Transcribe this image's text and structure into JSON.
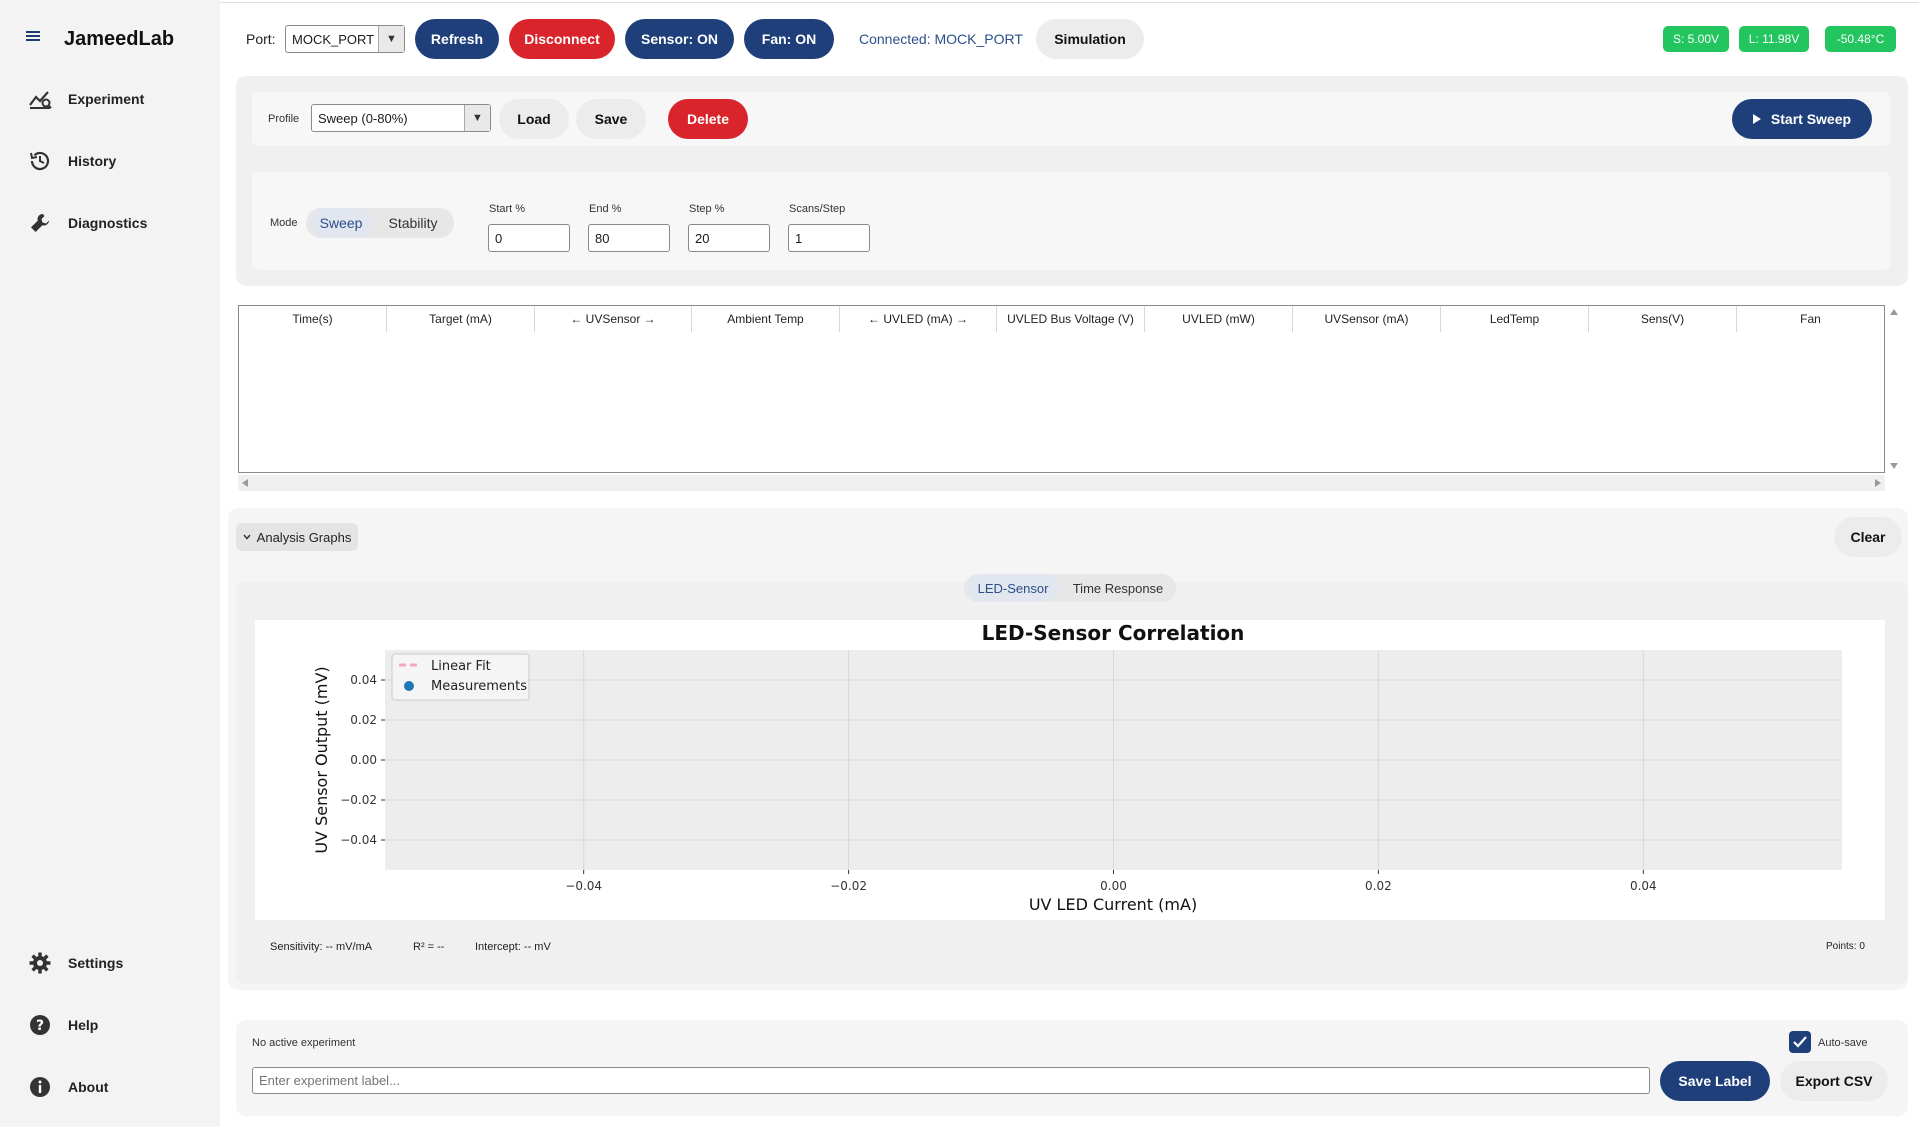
{
  "app": {
    "title": "JameedLab"
  },
  "sidebar": {
    "items": [
      {
        "label": "Experiment",
        "icon": "chart-line-icon"
      },
      {
        "label": "History",
        "icon": "history-icon"
      },
      {
        "label": "Diagnostics",
        "icon": "wrench-icon"
      }
    ],
    "bottom_items": [
      {
        "label": "Settings",
        "icon": "gear-icon"
      },
      {
        "label": "Help",
        "icon": "help-icon"
      },
      {
        "label": "About",
        "icon": "info-icon"
      }
    ]
  },
  "toolbar": {
    "port_label": "Port:",
    "port_value": "MOCK_PORT",
    "refresh_label": "Refresh",
    "disconnect_label": "Disconnect",
    "sensor_label": "Sensor: ON",
    "fan_label": "Fan: ON",
    "connection_text": "Connected: MOCK_PORT",
    "simulation_label": "Simulation",
    "badges": [
      "S: 5.00V",
      "L: 11.98V",
      "-50.48°C"
    ],
    "badge_color": "#22c55e"
  },
  "profile": {
    "label": "Profile",
    "value": "Sweep (0-80%)",
    "load_label": "Load",
    "save_label": "Save",
    "delete_label": "Delete",
    "start_label": "Start Sweep"
  },
  "mode": {
    "label": "Mode",
    "options": [
      "Sweep",
      "Stability"
    ],
    "selected": "Sweep",
    "fields": [
      {
        "label": "Start %",
        "value": "0"
      },
      {
        "label": "End %",
        "value": "80"
      },
      {
        "label": "Step %",
        "value": "20"
      },
      {
        "label": "Scans/Step",
        "value": "1"
      }
    ]
  },
  "table": {
    "columns": [
      "Time(s)",
      "Target (mA)",
      "← UVSensor →",
      "Ambient Temp",
      "← UVLED (mA) →",
      "UVLED Bus Voltage (V)",
      "UVLED (mW)",
      "UVSensor (mA)",
      "LedTemp",
      "Sens(V)",
      "Fan"
    ],
    "rows": []
  },
  "analysis": {
    "toggle_label": "Analysis Graphs",
    "clear_label": "Clear",
    "tabs": [
      "LED-Sensor",
      "Time Response"
    ],
    "active_tab": "LED-Sensor",
    "stats": {
      "sensitivity": "Sensitivity: -- mV/mA",
      "r2": "R² = --",
      "intercept": "Intercept: -- mV",
      "points": "Points: 0"
    }
  },
  "chart_data": {
    "type": "scatter",
    "title": "LED-Sensor Correlation",
    "xlabel": "UV LED Current (mA)",
    "ylabel": "UV Sensor Output (mV)",
    "xlim": [
      -0.055,
      0.055
    ],
    "ylim": [
      -0.055,
      0.055
    ],
    "x_ticks": [
      "−0.04",
      "−0.02",
      "0.00",
      "0.02",
      "0.04"
    ],
    "x_tick_values": [
      -0.04,
      -0.02,
      0.0,
      0.02,
      0.04
    ],
    "y_ticks": [
      "0.04",
      "0.02",
      "0.00",
      "−0.02",
      "−0.04"
    ],
    "y_tick_values": [
      0.04,
      0.02,
      0.0,
      -0.02,
      -0.04
    ],
    "grid": true,
    "legend_position": "top-left",
    "series": [
      {
        "name": "Linear Fit",
        "style": "dashed-line",
        "color": "#f4a6be",
        "values": []
      },
      {
        "name": "Measurements",
        "style": "marker",
        "color": "#1f77b4",
        "values": []
      }
    ]
  },
  "experiment": {
    "status": "No active experiment",
    "autosave_label": "Auto-save",
    "label_placeholder": "Enter experiment label...",
    "save_label_button": "Save Label",
    "export_label": "Export CSV"
  }
}
